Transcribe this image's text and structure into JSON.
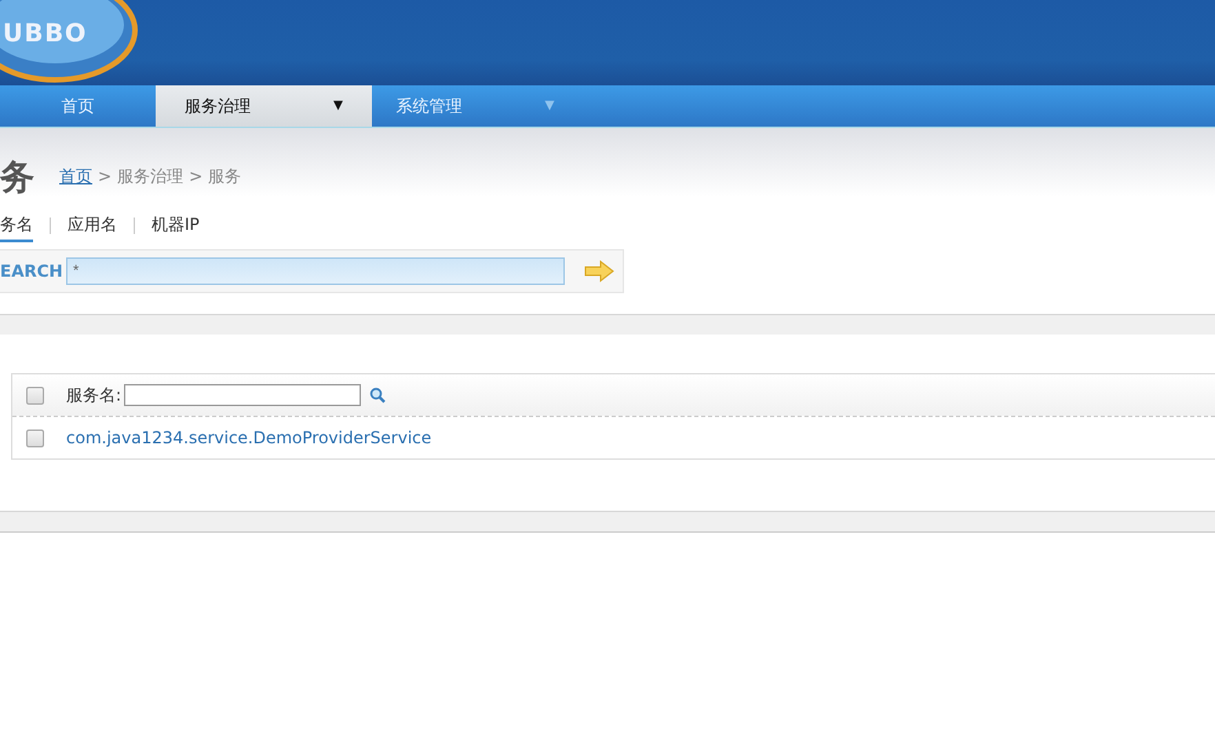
{
  "logo": {
    "text": "UBBO"
  },
  "nav": [
    {
      "label": "首页",
      "selected": false
    },
    {
      "label": "服务治理",
      "selected": true,
      "caret": "▼"
    },
    {
      "label": "系统管理",
      "selected": false,
      "caret": "▼"
    }
  ],
  "page_title": "务",
  "breadcrumb": {
    "separator": ">",
    "items": [
      {
        "label": "首页",
        "kind": "link"
      },
      {
        "label": "服务治理",
        "kind": "text"
      },
      {
        "label": "服务",
        "kind": "text"
      }
    ]
  },
  "search_tabs": [
    {
      "label": "务名",
      "selected": true
    },
    {
      "label": "应用名",
      "selected": false
    },
    {
      "label": "机器IP",
      "selected": false
    }
  ],
  "search": {
    "label": "EARCH",
    "value": "*"
  },
  "table": {
    "header_checked": false,
    "filter_label": "服务名:",
    "rows": [
      {
        "name": "com.java1234.service.DemoProviderService",
        "checked": false
      }
    ]
  }
}
